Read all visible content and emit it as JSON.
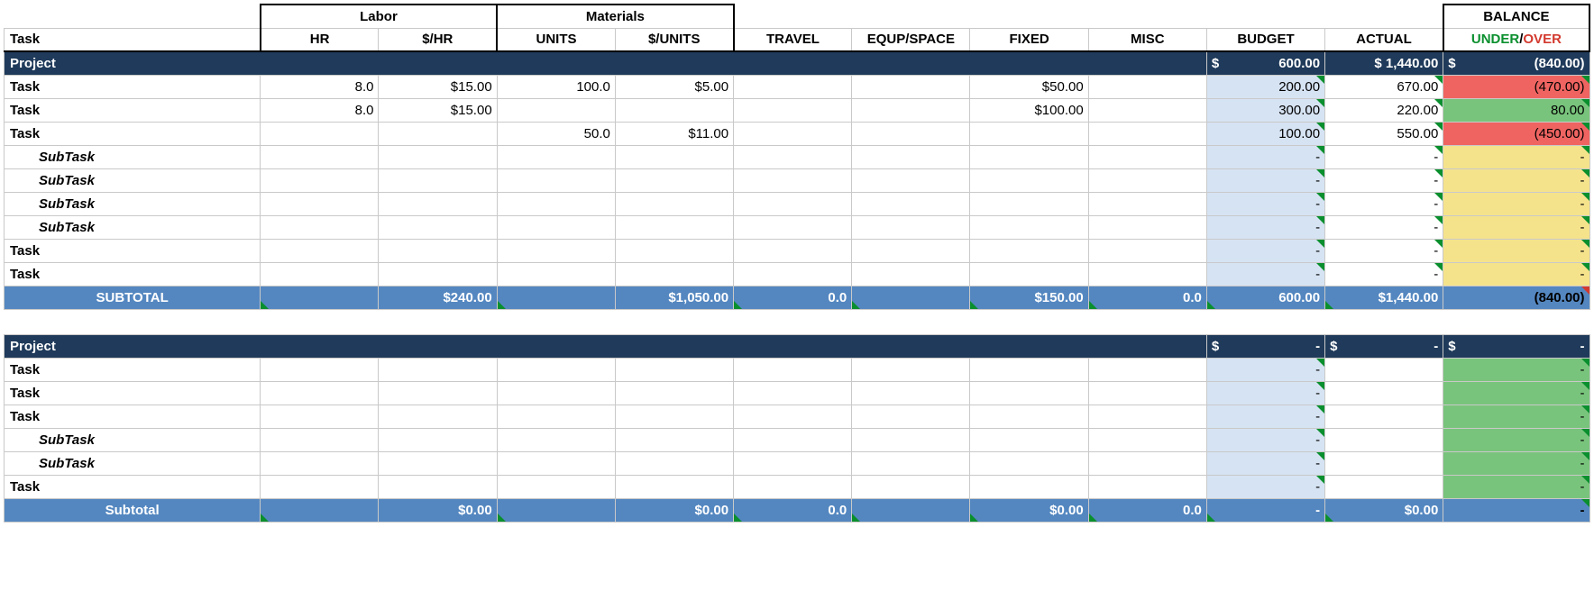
{
  "headers": {
    "task": "Task",
    "labor_group": "Labor",
    "labor_hr": "HR",
    "labor_rate": "$/HR",
    "materials_group": "Materials",
    "materials_units": "UNITS",
    "materials_rate": "$/UNITS",
    "travel": "TRAVEL",
    "equp_space": "EQUP/SPACE",
    "fixed": "FIXED",
    "misc": "MISC",
    "budget": "BUDGET",
    "actual": "ACTUAL",
    "balance": "BALANCE",
    "under": "UNDER",
    "slash": "/",
    "over": "OVER"
  },
  "p1": {
    "label": "Project",
    "budget_sym": "$",
    "budget": "600.00",
    "actual": "$ 1,440.00",
    "bal_sym": "$",
    "bal": "(840.00)",
    "rows": [
      {
        "name": "Task",
        "hr": "8.0",
        "rate": "$15.00",
        "units": "100.0",
        "urate": "$5.00",
        "travel": "",
        "equp": "",
        "fixed": "$50.00",
        "misc": "",
        "budget": "200.00",
        "actual": "670.00",
        "balance": "(470.00)",
        "balcls": "red",
        "indent": "indent1"
      },
      {
        "name": "Task",
        "hr": "8.0",
        "rate": "$15.00",
        "units": "",
        "urate": "",
        "travel": "",
        "equp": "",
        "fixed": "$100.00",
        "misc": "",
        "budget": "300.00",
        "actual": "220.00",
        "balance": "80.00",
        "balcls": "green",
        "indent": "indent1"
      },
      {
        "name": "Task",
        "hr": "",
        "rate": "",
        "units": "50.0",
        "urate": "$11.00",
        "travel": "",
        "equp": "",
        "fixed": "",
        "misc": "",
        "budget": "100.00",
        "actual": "550.00",
        "balance": "(450.00)",
        "balcls": "red",
        "indent": "indent1"
      },
      {
        "name": "SubTask",
        "hr": "",
        "rate": "",
        "units": "",
        "urate": "",
        "travel": "",
        "equp": "",
        "fixed": "",
        "misc": "",
        "budget": "-",
        "actual": "-",
        "balance": "-",
        "balcls": "yellow",
        "indent": "indent2",
        "ital": true
      },
      {
        "name": "SubTask",
        "hr": "",
        "rate": "",
        "units": "",
        "urate": "",
        "travel": "",
        "equp": "",
        "fixed": "",
        "misc": "",
        "budget": "-",
        "actual": "-",
        "balance": "-",
        "balcls": "yellow",
        "indent": "indent2",
        "ital": true
      },
      {
        "name": "SubTask",
        "hr": "",
        "rate": "",
        "units": "",
        "urate": "",
        "travel": "",
        "equp": "",
        "fixed": "",
        "misc": "",
        "budget": "-",
        "actual": "-",
        "balance": "-",
        "balcls": "yellow",
        "indent": "indent2",
        "ital": true
      },
      {
        "name": "SubTask",
        "hr": "",
        "rate": "",
        "units": "",
        "urate": "",
        "travel": "",
        "equp": "",
        "fixed": "",
        "misc": "",
        "budget": "-",
        "actual": "-",
        "balance": "-",
        "balcls": "yellow",
        "indent": "indent2",
        "ital": true
      },
      {
        "name": "Task",
        "hr": "",
        "rate": "",
        "units": "",
        "urate": "",
        "travel": "",
        "equp": "",
        "fixed": "",
        "misc": "",
        "budget": "-",
        "actual": "-",
        "balance": "-",
        "balcls": "yellow",
        "indent": "indent1"
      },
      {
        "name": "Task",
        "hr": "",
        "rate": "",
        "units": "",
        "urate": "",
        "travel": "",
        "equp": "",
        "fixed": "",
        "misc": "",
        "budget": "-",
        "actual": "-",
        "balance": "-",
        "balcls": "yellow",
        "indent": "indent1"
      }
    ],
    "subtotal_label": "SUBTOTAL",
    "sub": {
      "rate": "$240.00",
      "urate": "$1,050.00",
      "travel": "0.0",
      "fixed": "$150.00",
      "misc": "0.0",
      "budget": "600.00",
      "actual": "$1,440.00",
      "balance": "(840.00)"
    }
  },
  "p2": {
    "label": "Project",
    "budget_sym": "$",
    "budget": "-",
    "actual_sym": "$",
    "actual": "-",
    "bal_sym": "$",
    "bal": "-",
    "rows": [
      {
        "name": "Task",
        "budget": "-",
        "actual": "",
        "balance": "-",
        "balcls": "green",
        "indent": "indent1"
      },
      {
        "name": "Task",
        "budget": "-",
        "actual": "",
        "balance": "-",
        "balcls": "green",
        "indent": "indent1"
      },
      {
        "name": "Task",
        "budget": "-",
        "actual": "",
        "balance": "-",
        "balcls": "green",
        "indent": "indent1"
      },
      {
        "name": "SubTask",
        "budget": "-",
        "actual": "",
        "balance": "-",
        "balcls": "green",
        "indent": "indent2",
        "ital": true
      },
      {
        "name": "SubTask",
        "budget": "-",
        "actual": "",
        "balance": "-",
        "balcls": "green",
        "indent": "indent2",
        "ital": true
      },
      {
        "name": "Task",
        "budget": "-",
        "actual": "",
        "balance": "-",
        "balcls": "green",
        "indent": "indent1"
      }
    ],
    "subtotal_label": "Subtotal",
    "sub": {
      "rate": "$0.00",
      "urate": "$0.00",
      "travel": "0.0",
      "fixed": "$0.00",
      "misc": "0.0",
      "budget": "-",
      "actual": "$0.00",
      "balance": "-"
    }
  }
}
